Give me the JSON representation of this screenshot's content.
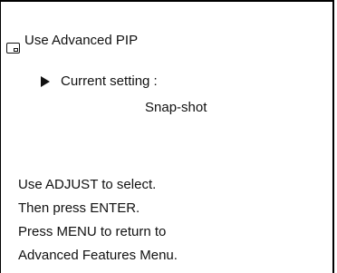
{
  "menu": {
    "title": "Use Advanced PIP",
    "icon": "pip-icon"
  },
  "setting": {
    "label": "Current setting :",
    "value": "Snap-shot",
    "marker_icon": "right-triangle-icon"
  },
  "instructions": {
    "lines": [
      "Use ADJUST to select.",
      "Then press ENTER.",
      "Press MENU to return to",
      "Advanced Features Menu."
    ]
  }
}
